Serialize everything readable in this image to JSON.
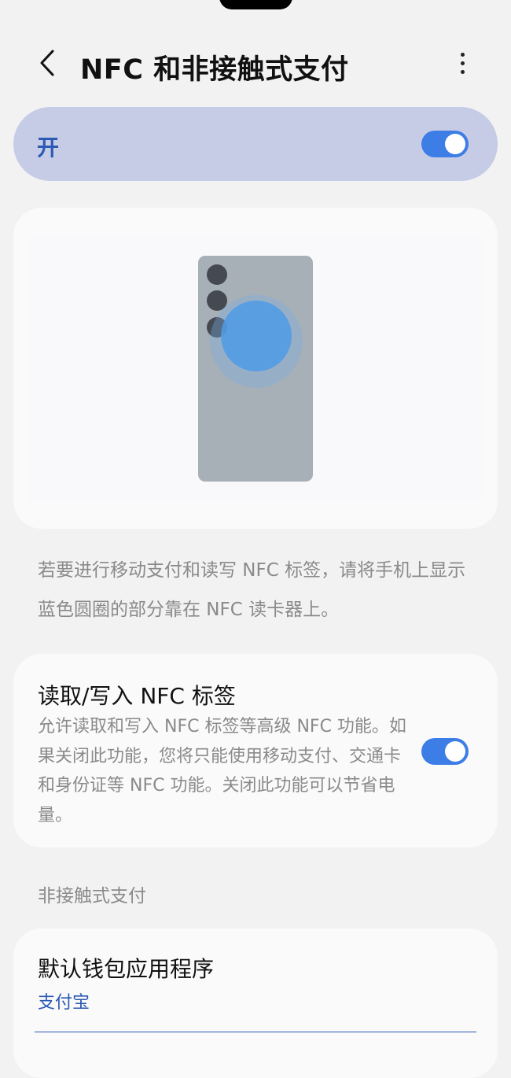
{
  "header": {
    "back_icon": "chevron-left-icon",
    "title": "NFC 和非接触式支付",
    "more_icon": "more-vertical-icon"
  },
  "master_switch": {
    "label": "开",
    "state": "on"
  },
  "illustration": {
    "description_text": "若要进行移动支付和读写 NFC 标签，请将手机上显示蓝色圆圈的部分靠在 NFC 读卡器上。"
  },
  "nfc_tag_setting": {
    "title": "读取/写入 NFC 标签",
    "description": "允许读取和写入 NFC 标签等高级 NFC 功能。如果关闭此功能，您将只能使用移动支付、交通卡和身份证等 NFC 功能。关闭此功能可以节省电量。",
    "state": "on"
  },
  "contactless_section": {
    "header": "非接触式支付",
    "default_wallet": {
      "title": "默认钱包应用程序",
      "value": "支付宝"
    }
  },
  "colors": {
    "accent": "#3d7de6",
    "link_blue": "#2b59b3",
    "master_bg": "#c6cbe6",
    "page_bg": "#f2f2f2",
    "card_bg": "#fbfafb",
    "secondary_text": "#8a8a8a"
  }
}
